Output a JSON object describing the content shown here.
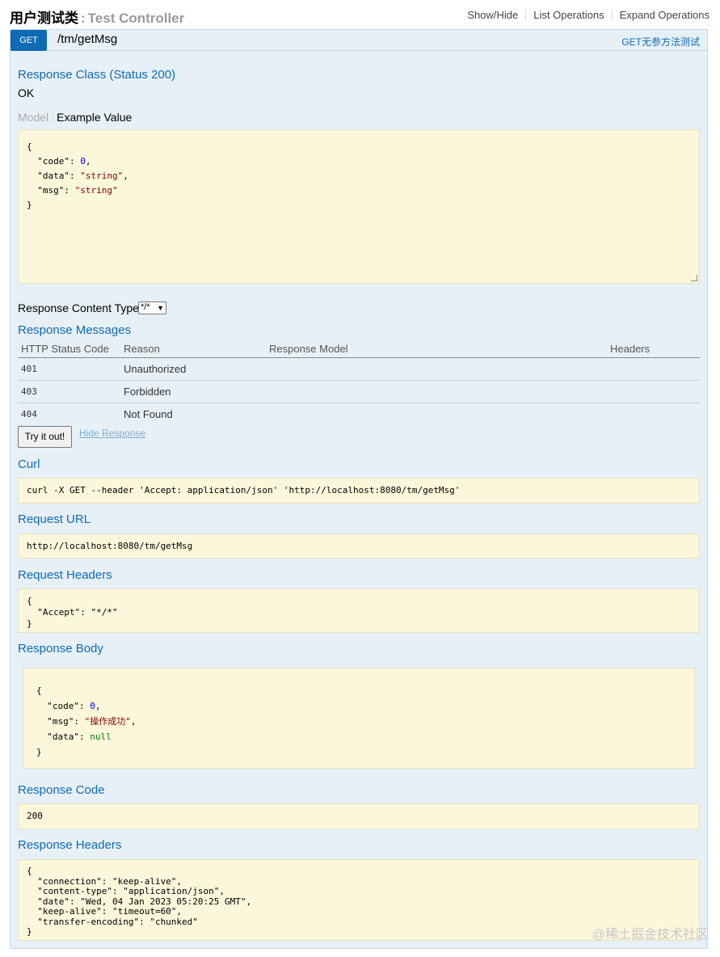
{
  "header": {
    "title_cn": "用户测试类",
    "title_sep": ":",
    "title_en": "Test Controller",
    "links": [
      "Show/Hide",
      "List Operations",
      "Expand Operations"
    ]
  },
  "operation": {
    "method": "GET",
    "path": "/tm/getMsg",
    "summary": "GET无参方法测试",
    "method_color": "#0f6ab4"
  },
  "response_class": {
    "heading": "Response Class (Status 200)",
    "value": "OK",
    "tabs": [
      "Model",
      "Example Value"
    ],
    "example_lines": [
      {
        "a": "{",
        "b": "",
        "c": ""
      },
      {
        "a": "  \"code\": ",
        "b": "0",
        "c": ","
      },
      {
        "a": "  \"data\": ",
        "b": "\"string\"",
        "c": ","
      },
      {
        "a": "  \"msg\": ",
        "b": "\"string\"",
        "c": ""
      },
      {
        "a": "}",
        "b": "",
        "c": ""
      }
    ]
  },
  "content_type": {
    "label": "Response Content Type",
    "selected": "*/*"
  },
  "response_messages": {
    "heading": "Response Messages",
    "columns": [
      "HTTP Status Code",
      "Reason",
      "Response Model",
      "Headers"
    ],
    "rows": [
      {
        "code": "401",
        "reason": "Unauthorized"
      },
      {
        "code": "403",
        "reason": "Forbidden"
      },
      {
        "code": "404",
        "reason": "Not Found"
      }
    ]
  },
  "actions": {
    "try_label": "Try it out!",
    "hide_label": "Hide Response"
  },
  "curl": {
    "heading": "Curl",
    "value": "curl -X GET --header 'Accept: application/json' 'http://localhost:8080/tm/getMsg'"
  },
  "request_url": {
    "heading": "Request URL",
    "value": "http://localhost:8080/tm/getMsg"
  },
  "request_headers": {
    "heading": "Request Headers",
    "lines": [
      "{",
      "  \"Accept\": \"*/*\"",
      "}"
    ]
  },
  "response_body": {
    "heading": "Response Body",
    "lines": [
      {
        "a": "{",
        "b": "",
        "c": ""
      },
      {
        "a": "  \"code\": ",
        "b": "0",
        "c": ","
      },
      {
        "a": "  \"msg\": ",
        "b": "\"操作成功\"",
        "c": ","
      },
      {
        "a": "  \"data\": ",
        "b": "null",
        "c": ""
      },
      {
        "a": "}",
        "b": "",
        "c": ""
      }
    ]
  },
  "response_code": {
    "heading": "Response Code",
    "value": "200"
  },
  "response_headers": {
    "heading": "Response Headers",
    "lines": [
      "{",
      "  \"connection\": \"keep-alive\",",
      "  \"content-type\": \"application/json\",",
      "  \"date\": \"Wed, 04 Jan 2023 05:20:25 GMT\",",
      "  \"keep-alive\": \"timeout=60\",",
      "  \"transfer-encoding\": \"chunked\"",
      "}"
    ]
  },
  "watermark": "@稀土掘金技术社区"
}
